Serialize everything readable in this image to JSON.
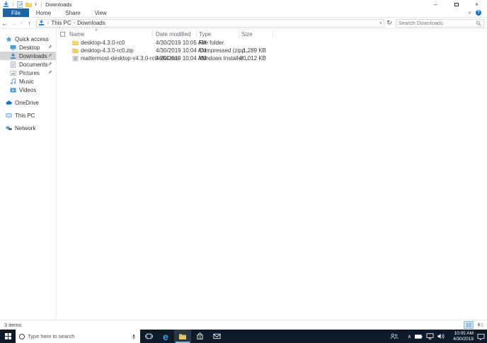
{
  "colors": {
    "accent_blue": "#1d63a8",
    "taskbar_bg": "#0e1b29",
    "selection_gray": "#d6d6d6",
    "help_blue": "#0b79d0",
    "folder_yellow": "#fcd462"
  },
  "title_bar": {
    "title": "Downloads"
  },
  "glyphs": {
    "minimize": "–",
    "close": "×",
    "back": "←",
    "forward": "→",
    "up": "↑",
    "chevron_down": "∨",
    "refresh": "↻",
    "crumb_sep": "›",
    "sort_asc": "∧",
    "tray_chevron": "∧",
    "edge": "e",
    "help": "?"
  },
  "ribbon": {
    "tabs": [
      {
        "label": "File"
      },
      {
        "label": "Home"
      },
      {
        "label": "Share"
      },
      {
        "label": "View"
      }
    ]
  },
  "address_bar": {
    "breadcrumb": [
      {
        "label": "This PC"
      },
      {
        "label": "Downloads"
      }
    ],
    "search_placeholder": "Search Downloads"
  },
  "sidebar": {
    "items": [
      {
        "label": "Quick access"
      },
      {
        "label": "Desktop"
      },
      {
        "label": "Downloads"
      },
      {
        "label": "Documents"
      },
      {
        "label": "Pictures"
      },
      {
        "label": "Music"
      },
      {
        "label": "Videos"
      },
      {
        "label": "OneDrive"
      },
      {
        "label": "This PC"
      },
      {
        "label": "Network"
      }
    ]
  },
  "file_list": {
    "columns": {
      "name": "Name",
      "date": "Date modified",
      "type": "Type",
      "size": "Size"
    },
    "rows": [
      {
        "name": "desktop-4.3.0-rc0",
        "date": "4/30/2019 10:05 AM",
        "type": "File folder",
        "size": ""
      },
      {
        "name": "desktop-4.3.0-rc0.zip",
        "date": "4/30/2019 10:04 AM",
        "type": "Compressed (zipp...",
        "size": "1,289 KB"
      },
      {
        "name": "mattermost-desktop-v4.3.0-rc0-x64.msi",
        "date": "4/30/2019 10:04 AM",
        "type": "Windows Installer ...",
        "size": "80,012 KB"
      }
    ]
  },
  "status_bar": {
    "items_count": "3 items"
  },
  "taskbar": {
    "search_placeholder": "Type here to search",
    "clock_time": "10:05 AM",
    "clock_date": "4/30/2019"
  }
}
